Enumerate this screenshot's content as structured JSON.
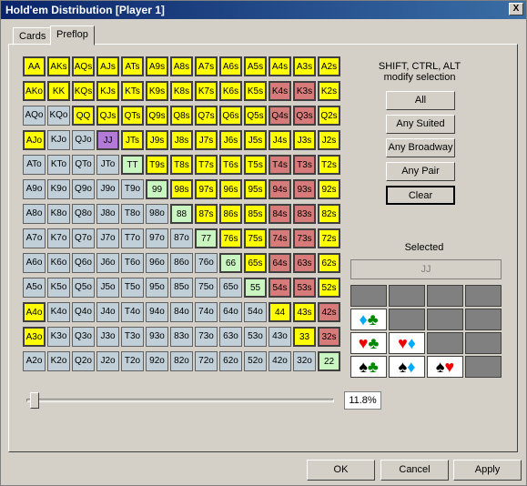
{
  "window": {
    "title": "Hold'em Distribution [Player 1]",
    "close": "X"
  },
  "tabs": [
    {
      "label": "Cards"
    },
    {
      "label": "Preflop"
    }
  ],
  "hint": [
    "SHIFT, CTRL, ALT",
    "modify selection"
  ],
  "buttons": {
    "all": "All",
    "any_suited": "Any Suited",
    "any_broadway": "Any Broadway",
    "any_pair": "Any Pair",
    "clear": "Clear"
  },
  "selected": {
    "label": "Selected",
    "value": "JJ"
  },
  "combos": [
    [
      "",
      "",
      "",
      ""
    ],
    [
      "♦♣",
      "",
      "",
      ""
    ],
    [
      "♥♣",
      "♥♦",
      "",
      ""
    ],
    [
      "♠♣",
      "♠♦",
      "♠♥",
      ""
    ]
  ],
  "slider": {
    "value_percent": 11.8,
    "display": "11.8%"
  },
  "bottom": {
    "ok": "OK",
    "cancel": "Cancel",
    "apply": "Apply"
  },
  "colors": {
    "yellow": "#ffff00",
    "red": "#d77a7a",
    "green": "#c8f5c0",
    "purple": "#b37ad7",
    "gray": "#c0cfd8"
  },
  "grid": [
    [
      [
        "AA",
        "yellow"
      ],
      [
        "AKs",
        "yellow"
      ],
      [
        "AQs",
        "yellow"
      ],
      [
        "AJs",
        "yellow"
      ],
      [
        "ATs",
        "yellow"
      ],
      [
        "A9s",
        "yellow"
      ],
      [
        "A8s",
        "yellow"
      ],
      [
        "A7s",
        "yellow"
      ],
      [
        "A6s",
        "yellow"
      ],
      [
        "A5s",
        "yellow"
      ],
      [
        "A4s",
        "yellow"
      ],
      [
        "A3s",
        "yellow"
      ],
      [
        "A2s",
        "yellow"
      ]
    ],
    [
      [
        "AKo",
        "yellow"
      ],
      [
        "KK",
        "yellow"
      ],
      [
        "KQs",
        "yellow"
      ],
      [
        "KJs",
        "yellow"
      ],
      [
        "KTs",
        "yellow"
      ],
      [
        "K9s",
        "yellow"
      ],
      [
        "K8s",
        "yellow"
      ],
      [
        "K7s",
        "yellow"
      ],
      [
        "K6s",
        "yellow"
      ],
      [
        "K5s",
        "yellow"
      ],
      [
        "K4s",
        "red"
      ],
      [
        "K3s",
        "red"
      ],
      [
        "K2s",
        "yellow"
      ]
    ],
    [
      [
        "AQo",
        "gray"
      ],
      [
        "KQo",
        "gray"
      ],
      [
        "QQ",
        "yellow"
      ],
      [
        "QJs",
        "yellow"
      ],
      [
        "QTs",
        "yellow"
      ],
      [
        "Q9s",
        "yellow"
      ],
      [
        "Q8s",
        "yellow"
      ],
      [
        "Q7s",
        "yellow"
      ],
      [
        "Q6s",
        "yellow"
      ],
      [
        "Q5s",
        "yellow"
      ],
      [
        "Q4s",
        "red"
      ],
      [
        "Q3s",
        "red"
      ],
      [
        "Q2s",
        "yellow"
      ]
    ],
    [
      [
        "AJo",
        "yellow"
      ],
      [
        "KJo",
        "gray"
      ],
      [
        "QJo",
        "gray"
      ],
      [
        "JJ",
        "purple"
      ],
      [
        "JTs",
        "yellow"
      ],
      [
        "J9s",
        "yellow"
      ],
      [
        "J8s",
        "yellow"
      ],
      [
        "J7s",
        "yellow"
      ],
      [
        "J6s",
        "yellow"
      ],
      [
        "J5s",
        "yellow"
      ],
      [
        "J4s",
        "yellow"
      ],
      [
        "J3s",
        "yellow"
      ],
      [
        "J2s",
        "yellow"
      ]
    ],
    [
      [
        "ATo",
        "gray"
      ],
      [
        "KTo",
        "gray"
      ],
      [
        "QTo",
        "gray"
      ],
      [
        "JTo",
        "gray"
      ],
      [
        "TT",
        "green"
      ],
      [
        "T9s",
        "yellow"
      ],
      [
        "T8s",
        "yellow"
      ],
      [
        "T7s",
        "yellow"
      ],
      [
        "T6s",
        "yellow"
      ],
      [
        "T5s",
        "yellow"
      ],
      [
        "T4s",
        "red"
      ],
      [
        "T3s",
        "red"
      ],
      [
        "T2s",
        "yellow"
      ]
    ],
    [
      [
        "A9o",
        "gray"
      ],
      [
        "K9o",
        "gray"
      ],
      [
        "Q9o",
        "gray"
      ],
      [
        "J9o",
        "gray"
      ],
      [
        "T9o",
        "gray"
      ],
      [
        "99",
        "green"
      ],
      [
        "98s",
        "yellow"
      ],
      [
        "97s",
        "yellow"
      ],
      [
        "96s",
        "yellow"
      ],
      [
        "95s",
        "yellow"
      ],
      [
        "94s",
        "red"
      ],
      [
        "93s",
        "red"
      ],
      [
        "92s",
        "yellow"
      ]
    ],
    [
      [
        "A8o",
        "gray"
      ],
      [
        "K8o",
        "gray"
      ],
      [
        "Q8o",
        "gray"
      ],
      [
        "J8o",
        "gray"
      ],
      [
        "T8o",
        "gray"
      ],
      [
        "98o",
        "gray"
      ],
      [
        "88",
        "green"
      ],
      [
        "87s",
        "yellow"
      ],
      [
        "86s",
        "yellow"
      ],
      [
        "85s",
        "yellow"
      ],
      [
        "84s",
        "red"
      ],
      [
        "83s",
        "red"
      ],
      [
        "82s",
        "yellow"
      ]
    ],
    [
      [
        "A7o",
        "gray"
      ],
      [
        "K7o",
        "gray"
      ],
      [
        "Q7o",
        "gray"
      ],
      [
        "J7o",
        "gray"
      ],
      [
        "T7o",
        "gray"
      ],
      [
        "97o",
        "gray"
      ],
      [
        "87o",
        "gray"
      ],
      [
        "77",
        "green"
      ],
      [
        "76s",
        "yellow"
      ],
      [
        "75s",
        "yellow"
      ],
      [
        "74s",
        "red"
      ],
      [
        "73s",
        "red"
      ],
      [
        "72s",
        "yellow"
      ]
    ],
    [
      [
        "A6o",
        "gray"
      ],
      [
        "K6o",
        "gray"
      ],
      [
        "Q6o",
        "gray"
      ],
      [
        "J6o",
        "gray"
      ],
      [
        "T6o",
        "gray"
      ],
      [
        "96o",
        "gray"
      ],
      [
        "86o",
        "gray"
      ],
      [
        "76o",
        "gray"
      ],
      [
        "66",
        "green"
      ],
      [
        "65s",
        "yellow"
      ],
      [
        "64s",
        "red"
      ],
      [
        "63s",
        "red"
      ],
      [
        "62s",
        "yellow"
      ]
    ],
    [
      [
        "A5o",
        "gray"
      ],
      [
        "K5o",
        "gray"
      ],
      [
        "Q5o",
        "gray"
      ],
      [
        "J5o",
        "gray"
      ],
      [
        "T5o",
        "gray"
      ],
      [
        "95o",
        "gray"
      ],
      [
        "85o",
        "gray"
      ],
      [
        "75o",
        "gray"
      ],
      [
        "65o",
        "gray"
      ],
      [
        "55",
        "green"
      ],
      [
        "54s",
        "red"
      ],
      [
        "53s",
        "red"
      ],
      [
        "52s",
        "yellow"
      ]
    ],
    [
      [
        "A4o",
        "yellow"
      ],
      [
        "K4o",
        "gray"
      ],
      [
        "Q4o",
        "gray"
      ],
      [
        "J4o",
        "gray"
      ],
      [
        "T4o",
        "gray"
      ],
      [
        "94o",
        "gray"
      ],
      [
        "84o",
        "gray"
      ],
      [
        "74o",
        "gray"
      ],
      [
        "64o",
        "gray"
      ],
      [
        "54o",
        "gray"
      ],
      [
        "44",
        "yellow"
      ],
      [
        "43s",
        "yellow"
      ],
      [
        "42s",
        "red"
      ]
    ],
    [
      [
        "A3o",
        "yellow"
      ],
      [
        "K3o",
        "gray"
      ],
      [
        "Q3o",
        "gray"
      ],
      [
        "J3o",
        "gray"
      ],
      [
        "T3o",
        "gray"
      ],
      [
        "93o",
        "gray"
      ],
      [
        "83o",
        "gray"
      ],
      [
        "73o",
        "gray"
      ],
      [
        "63o",
        "gray"
      ],
      [
        "53o",
        "gray"
      ],
      [
        "43o",
        "gray"
      ],
      [
        "33",
        "yellow"
      ],
      [
        "32s",
        "red"
      ]
    ],
    [
      [
        "A2o",
        "gray"
      ],
      [
        "K2o",
        "gray"
      ],
      [
        "Q2o",
        "gray"
      ],
      [
        "J2o",
        "gray"
      ],
      [
        "T2o",
        "gray"
      ],
      [
        "92o",
        "gray"
      ],
      [
        "82o",
        "gray"
      ],
      [
        "72o",
        "gray"
      ],
      [
        "62o",
        "gray"
      ],
      [
        "52o",
        "gray"
      ],
      [
        "42o",
        "gray"
      ],
      [
        "32o",
        "gray"
      ],
      [
        "22",
        "green"
      ]
    ]
  ]
}
